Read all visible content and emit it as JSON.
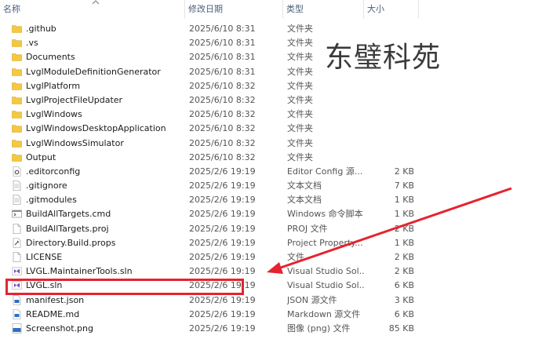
{
  "header": {
    "name": "名称",
    "modified": "修改日期",
    "type": "类型",
    "size": "大小"
  },
  "watermark": "东璧科苑",
  "colors": {
    "folder": "#f4c842",
    "annotation": "#e52330",
    "header_text": "#4c607a"
  },
  "files": [
    {
      "icon": "folder-icon",
      "name": ".github",
      "date": "2025/6/10 8:31",
      "type": "文件夹",
      "size": ""
    },
    {
      "icon": "folder-icon",
      "name": ".vs",
      "date": "2025/6/10 8:31",
      "type": "文件夹",
      "size": ""
    },
    {
      "icon": "folder-icon",
      "name": "Documents",
      "date": "2025/6/10 8:31",
      "type": "文件夹",
      "size": ""
    },
    {
      "icon": "folder-icon",
      "name": "LvglModuleDefinitionGenerator",
      "date": "2025/6/10 8:31",
      "type": "文件夹",
      "size": ""
    },
    {
      "icon": "folder-icon",
      "name": "LvglPlatform",
      "date": "2025/6/10 8:32",
      "type": "文件夹",
      "size": ""
    },
    {
      "icon": "folder-icon",
      "name": "LvglProjectFileUpdater",
      "date": "2025/6/10 8:32",
      "type": "文件夹",
      "size": ""
    },
    {
      "icon": "folder-icon",
      "name": "LvglWindows",
      "date": "2025/6/10 8:32",
      "type": "文件夹",
      "size": ""
    },
    {
      "icon": "folder-icon",
      "name": "LvglWindowsDesktopApplication",
      "date": "2025/6/10 8:32",
      "type": "文件夹",
      "size": ""
    },
    {
      "icon": "folder-icon",
      "name": "LvglWindowsSimulator",
      "date": "2025/6/10 8:32",
      "type": "文件夹",
      "size": ""
    },
    {
      "icon": "folder-icon",
      "name": "Output",
      "date": "2025/6/10 8:32",
      "type": "文件夹",
      "size": ""
    },
    {
      "icon": "config-file-icon",
      "name": ".editorconfig",
      "date": "2025/2/6 19:19",
      "type": "Editor Config 源...",
      "size": "2 KB"
    },
    {
      "icon": "text-file-icon",
      "name": ".gitignore",
      "date": "2025/2/6 19:19",
      "type": "文本文档",
      "size": "7 KB"
    },
    {
      "icon": "text-file-icon",
      "name": ".gitmodules",
      "date": "2025/2/6 19:19",
      "type": "文本文档",
      "size": "1 KB"
    },
    {
      "icon": "cmd-file-icon",
      "name": "BuildAllTargets.cmd",
      "date": "2025/2/6 19:19",
      "type": "Windows 命令脚本",
      "size": "1 KB"
    },
    {
      "icon": "blank-file-icon",
      "name": "BuildAllTargets.proj",
      "date": "2025/2/6 19:19",
      "type": "PROJ 文件",
      "size": "2 KB"
    },
    {
      "icon": "props-file-icon",
      "name": "Directory.Build.props",
      "date": "2025/2/6 19:19",
      "type": "Project Property...",
      "size": "1 KB"
    },
    {
      "icon": "blank-file-icon",
      "name": "LICENSE",
      "date": "2025/2/6 19:19",
      "type": "文件",
      "size": "2 KB"
    },
    {
      "icon": "vs-solution-icon",
      "name": "LVGL.MaintainerTools.sln",
      "date": "2025/2/6 19:19",
      "type": "Visual Studio Sol...",
      "size": "2 KB"
    },
    {
      "icon": "vs-solution-icon",
      "name": "LVGL.sln",
      "date": "2025/2/6 19:19",
      "type": "Visual Studio Sol...",
      "size": "6 KB"
    },
    {
      "icon": "json-file-icon",
      "name": "manifest.json",
      "date": "2025/2/6 19:19",
      "type": "JSON 源文件",
      "size": "3 KB"
    },
    {
      "icon": "markdown-file-icon",
      "name": "README.md",
      "date": "2025/2/6 19:19",
      "type": "Markdown 源文件",
      "size": "6 KB"
    },
    {
      "icon": "png-file-icon",
      "name": "Screenshot.png",
      "date": "2025/2/6 19:19",
      "type": "图像 (png) 文件",
      "size": "85 KB"
    }
  ]
}
